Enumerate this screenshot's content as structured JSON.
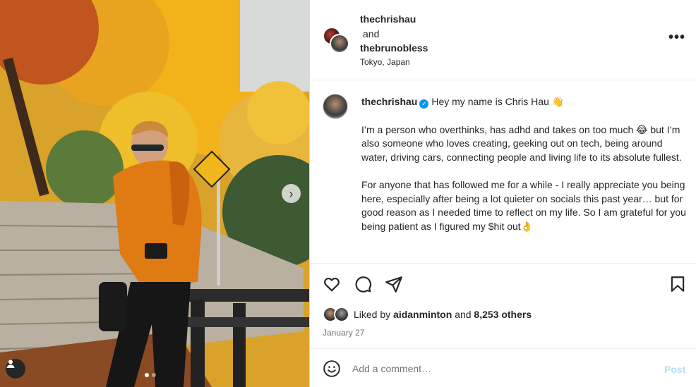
{
  "post": {
    "image_alt": "Man in orange jacket leaning on a fence under autumn trees",
    "carousel": {
      "current": 1,
      "total": 2
    }
  },
  "header": {
    "user1": "thechrishau",
    "conjunction": "and",
    "user2": "thebrunobless",
    "location": "Tokyo, Japan",
    "more_icon": "more-horizontal-icon"
  },
  "caption": {
    "username": "thechrishau",
    "verified": true,
    "first_line": "Hey my name is Chris Hau 👋",
    "body": "I’m a person who overthinks, has adhd and takes on too much 😂 but I’m also someone who loves creating, geeking out on tech, being around water, driving cars, connecting people and living life to its absolute fullest.\n\nFor anyone that has followed me for a while - I really appreciate you being here, especially after being a lot quieter on socials this past year… but for good reason as I needed time to reflect on my life. So I am grateful for you being patient as I figured my $hit out👌"
  },
  "actions": {
    "like_icon": "heart-icon",
    "comment_icon": "comment-icon",
    "share_icon": "share-icon",
    "save_icon": "bookmark-icon",
    "liked_prefix": "Liked by",
    "liked_user": "aidanminton",
    "liked_and": "and",
    "liked_others": "8,253 others",
    "date": "January 27"
  },
  "comment_box": {
    "placeholder": "Add a comment…",
    "post_label": "Post"
  },
  "colors": {
    "accent": "#0095f6",
    "post_disabled": "#b2dffc",
    "muted": "#737373"
  }
}
